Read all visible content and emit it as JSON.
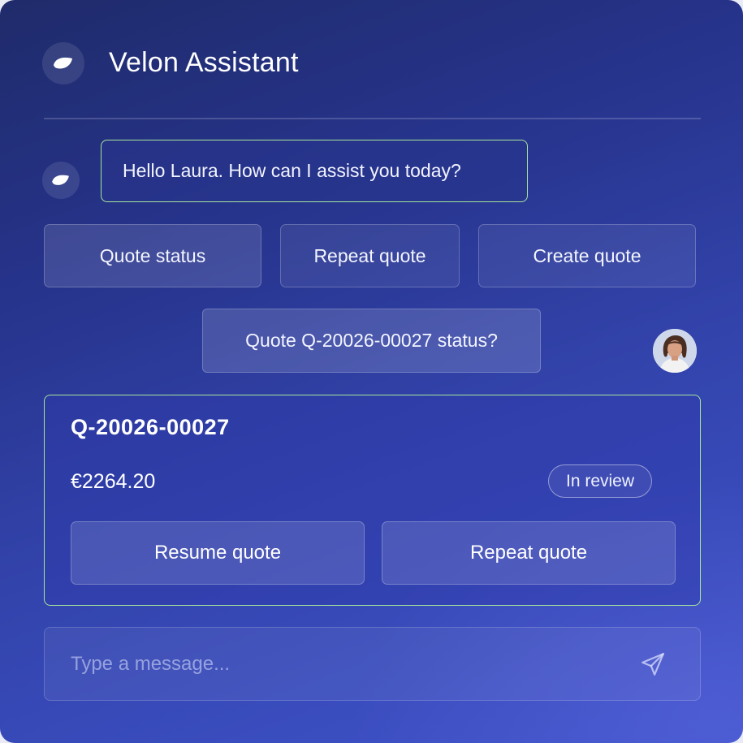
{
  "app": {
    "title": "Velon Assistant",
    "logo_icon": "leaf-logo-icon"
  },
  "chat": {
    "bot_message": "Hello Laura. How can I assist you today?",
    "quick_replies": [
      {
        "label": "Quote status"
      },
      {
        "label": "Repeat quote"
      },
      {
        "label": "Create quote"
      }
    ],
    "user_message": "Quote Q-20026-00027 status?",
    "user_avatar": "user-avatar-laura"
  },
  "quote_card": {
    "id": "Q-20026-00027",
    "amount": "€2264.20",
    "status": "In review",
    "actions": [
      {
        "label": "Resume quote"
      },
      {
        "label": "Repeat quote"
      }
    ]
  },
  "composer": {
    "placeholder": "Type a message...",
    "send_icon": "send-icon"
  },
  "colors": {
    "accent_border": "#a6e59c",
    "background_top": "#1f2b6a",
    "background_bottom": "#4054cc"
  }
}
